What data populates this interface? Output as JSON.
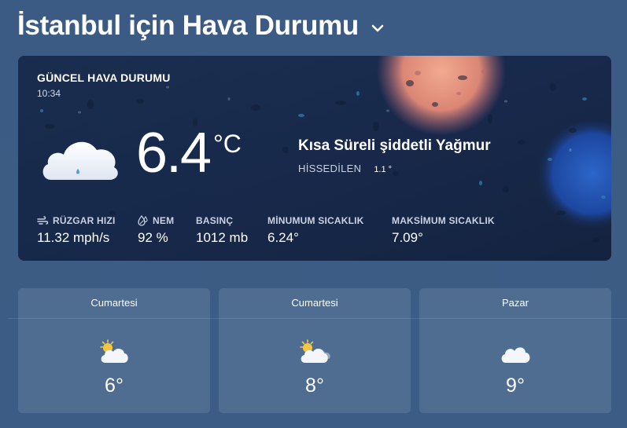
{
  "header": {
    "title": "İstanbul için Hava Durumu"
  },
  "current": {
    "title": "GÜNCEL HAVA DURUMU",
    "time": "10:34",
    "temperature": "6.4",
    "unit": "°C",
    "description": "Kısa Süreli şiddetli Yağmur",
    "feels_label": "HİSSEDİLEN",
    "feels_value": "1.1 °",
    "stats": {
      "wind": {
        "label": "RÜZGAR HIZI",
        "value": "11.32 mph/s"
      },
      "humidity": {
        "label": "NEM",
        "value": "92 %"
      },
      "pressure": {
        "label": "BASINÇ",
        "value": "1012 mb"
      },
      "min_temp": {
        "label": "MİNUMUM SICAKLIK",
        "value": "6.24°"
      },
      "max_temp": {
        "label": "MAKSİMUM SICAKLIK",
        "value": "7.09°"
      }
    }
  },
  "forecast": [
    {
      "day": "Cumartesi",
      "temp": "6°",
      "icon": "partly-cloudy-icon"
    },
    {
      "day": "Cumartesi",
      "temp": "8°",
      "icon": "partly-cloudy-dark-icon"
    },
    {
      "day": "Pazar",
      "temp": "9°",
      "icon": "cloud-icon"
    }
  ],
  "colors": {
    "page_bg": "#3b5b84",
    "card_bg": "#16294a",
    "accent_bubble": "#e79a83"
  }
}
